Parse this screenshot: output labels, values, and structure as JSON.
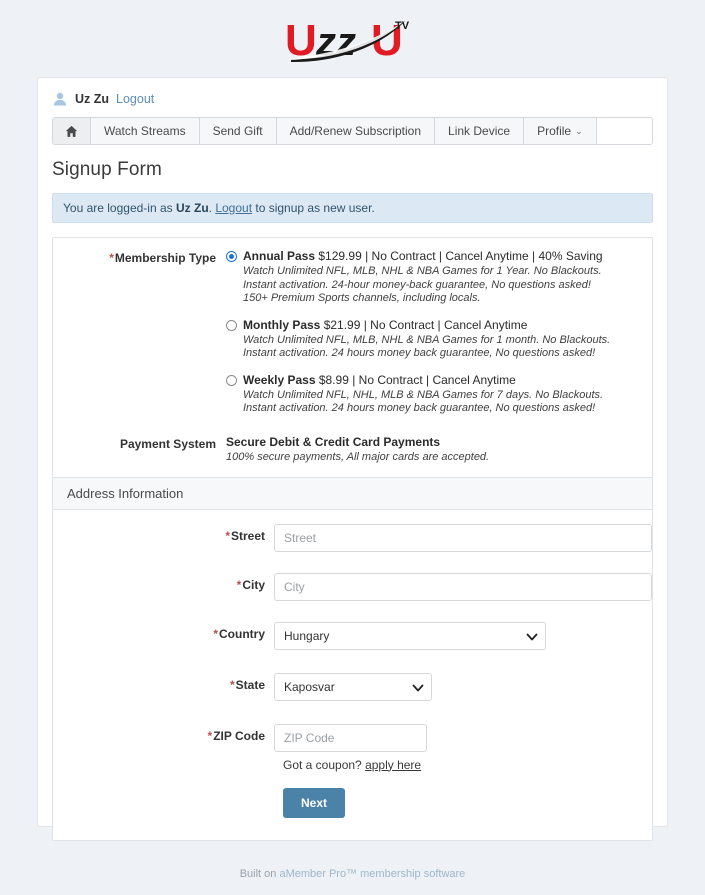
{
  "logo": {
    "text_u1": "U",
    "text_zz": "zz",
    "text_u2": "U",
    "text_tv": "TV"
  },
  "userbar": {
    "icon": "user-icon",
    "name": "Uz Zu",
    "logout_label": "Logout"
  },
  "nav": {
    "items": [
      {
        "label": "",
        "icon": "home-icon",
        "active": true
      },
      {
        "label": "Watch Streams"
      },
      {
        "label": "Send Gift"
      },
      {
        "label": "Add/Renew Subscription"
      },
      {
        "label": "Link Device"
      },
      {
        "label": "Profile",
        "caret": "⌄"
      }
    ]
  },
  "page": {
    "title": "Signup Form"
  },
  "alert": {
    "prefix": "You are logged-in as ",
    "user": "Uz Zu",
    "middle": ". ",
    "link": "Logout",
    "suffix": " to signup as new user."
  },
  "membership": {
    "label": "Membership Type",
    "required_mark": "*",
    "options": [
      {
        "title_bold": "Annual Pass",
        "title_rest": " $129.99 | No Contract | Cancel Anytime | 40% Saving",
        "desc": "Watch Unlimited NFL, MLB, NHL & NBA Games for 1 Year. No Blackouts. Instant activation. 24-hour money-back guarantee, No questions asked! 150+ Premium Sports channels, including locals.",
        "selected": true
      },
      {
        "title_bold": "Monthly Pass",
        "title_rest": " $21.99 | No Contract | Cancel Anytime",
        "desc": "Watch Unlimited NFL, MLB, NHL & NBA Games for 1 month. No Blackouts. Instant activation. 24 hours money back guarantee, No questions asked!",
        "selected": false
      },
      {
        "title_bold": "Weekly Pass",
        "title_rest": " $8.99 | No Contract | Cancel Anytime",
        "desc": "Watch Unlimited NFL, NHL, MLB & NBA Games for 7 days. No Blackouts. Instant activation. 24 hours money back guarantee, No questions asked!",
        "selected": false
      }
    ]
  },
  "payment": {
    "label": "Payment System",
    "title": "Secure Debit & Credit Card Payments",
    "desc": "100% secure payments, All major cards are accepted."
  },
  "address": {
    "section_title": "Address Information",
    "street": {
      "label": "Street",
      "required_mark": "*",
      "value": "",
      "placeholder": "Street"
    },
    "city": {
      "label": "City",
      "required_mark": "*",
      "value": "",
      "placeholder": "City"
    },
    "country": {
      "label": "Country",
      "required_mark": "*",
      "value": "Hungary"
    },
    "state": {
      "label": "State",
      "required_mark": "*",
      "value": "Kaposvar"
    },
    "zip": {
      "label": "ZIP Code",
      "required_mark": "*",
      "value": "",
      "placeholder": "ZIP Code"
    }
  },
  "coupon": {
    "text": "Got a coupon? ",
    "link": "apply here"
  },
  "actions": {
    "next_label": "Next"
  },
  "footer": {
    "prefix": "Built on ",
    "link": "aMember Pro™ membership software"
  },
  "colors": {
    "page_bg": "#eef1f5",
    "accent_button": "#4a82a8",
    "alert_bg": "#dce8f3",
    "logo_red": "#e01b24",
    "logo_black": "#1a1a1a",
    "required": "#b3524c",
    "radio_selected": "#1a6fd4"
  }
}
